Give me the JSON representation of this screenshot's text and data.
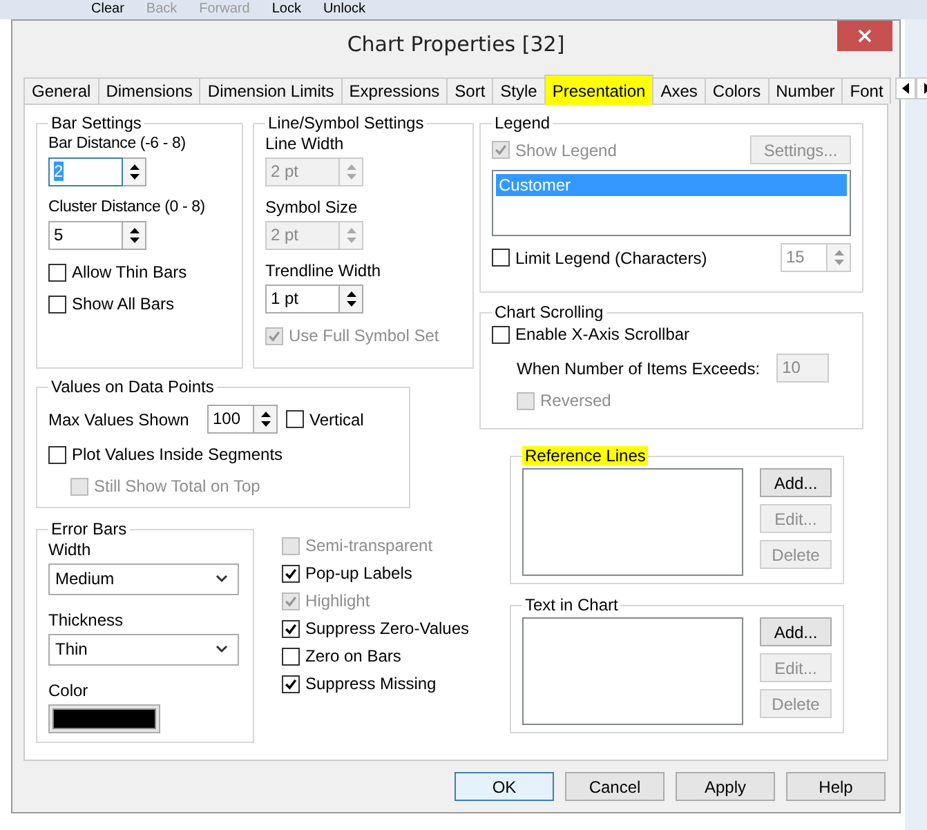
{
  "background_toolbar": [
    {
      "label": "Clear",
      "disabled": false
    },
    {
      "label": "Back",
      "disabled": true
    },
    {
      "label": "Forward",
      "disabled": true
    },
    {
      "label": "Lock",
      "disabled": false
    },
    {
      "label": "Unlock",
      "disabled": false
    }
  ],
  "window": {
    "title": "Chart Properties [32]"
  },
  "tabs": [
    {
      "label": "General",
      "selected": false,
      "highlighted": false
    },
    {
      "label": "Dimensions",
      "selected": false,
      "highlighted": false
    },
    {
      "label": "Dimension Limits",
      "selected": false,
      "highlighted": false
    },
    {
      "label": "Expressions",
      "selected": false,
      "highlighted": false
    },
    {
      "label": "Sort",
      "selected": false,
      "highlighted": false
    },
    {
      "label": "Style",
      "selected": false,
      "highlighted": false
    },
    {
      "label": "Presentation",
      "selected": true,
      "highlighted": true
    },
    {
      "label": "Axes",
      "selected": false,
      "highlighted": false
    },
    {
      "label": "Colors",
      "selected": false,
      "highlighted": false
    },
    {
      "label": "Number",
      "selected": false,
      "highlighted": false
    },
    {
      "label": "Font",
      "selected": false,
      "highlighted": false
    }
  ],
  "bar_settings": {
    "title": "Bar Settings",
    "fields": [
      {
        "label": "Bar Distance (-6 - 8)",
        "value": "2",
        "focused": true,
        "disabled": false
      },
      {
        "label": "Cluster Distance (0 - 8)",
        "value": "5",
        "focused": false,
        "disabled": false
      }
    ],
    "checkboxes": [
      {
        "label": "Allow Thin Bars",
        "checked": false,
        "disabled": false
      },
      {
        "label": "Show All Bars",
        "checked": false,
        "disabled": false
      }
    ]
  },
  "line_symbol_settings": {
    "title": "Line/Symbol Settings",
    "fields": [
      {
        "label": "Line Width",
        "value": "2 pt",
        "focused": false,
        "disabled": true
      },
      {
        "label": "Symbol Size",
        "value": "2 pt",
        "focused": false,
        "disabled": true
      },
      {
        "label": "Trendline Width",
        "value": "1 pt",
        "focused": false,
        "disabled": false
      }
    ],
    "checkbox": {
      "label": "Use Full Symbol Set",
      "checked": true,
      "disabled": true
    }
  },
  "values_on_data_points": {
    "title": "Values on Data Points",
    "max_values_label": "Max Values Shown",
    "max_values": "100",
    "vertical": {
      "label": "Vertical",
      "checked": false,
      "disabled": false
    },
    "plot_inside": {
      "label": "Plot Values Inside Segments",
      "checked": false,
      "disabled": false
    },
    "still_show_total": {
      "label": "Still Show Total on Top",
      "checked": false,
      "disabled": true
    }
  },
  "error_bars": {
    "title": "Error Bars",
    "width_label": "Width",
    "width": "Medium",
    "thickness_label": "Thickness",
    "thickness": "Thin",
    "color_label": "Color",
    "color": "#000000"
  },
  "options": [
    {
      "label": "Semi-transparent",
      "checked": false,
      "disabled": true
    },
    {
      "label": "Pop-up Labels",
      "checked": true,
      "disabled": false
    },
    {
      "label": "Highlight",
      "checked": true,
      "disabled": true
    },
    {
      "label": "Suppress Zero-Values",
      "checked": true,
      "disabled": false,
      "children": [
        {
          "label": "Zero on Bars",
          "checked": false,
          "disabled": false
        }
      ]
    },
    {
      "label": "Suppress Missing",
      "checked": true,
      "disabled": false
    }
  ],
  "legend": {
    "title": "Legend",
    "show_legend": {
      "label": "Show Legend",
      "checked": true,
      "disabled": true
    },
    "settings_button": {
      "label": "Settings...",
      "disabled": true
    },
    "items": [
      {
        "label": "Customer",
        "selected": true
      }
    ],
    "limit": {
      "label": "Limit Legend (Characters)",
      "checked": false,
      "disabled": false
    },
    "limit_value": "15",
    "limit_value_disabled": true
  },
  "chart_scrolling": {
    "title": "Chart Scrolling",
    "enable": {
      "label": "Enable X-Axis Scrollbar",
      "checked": false,
      "disabled": false
    },
    "exceeds_label": "When Number of Items Exceeds:",
    "exceeds_value": "10",
    "exceeds_disabled": true,
    "reversed": {
      "label": "Reversed",
      "checked": false,
      "disabled": true
    }
  },
  "reference_lines": {
    "title": "Reference Lines",
    "highlighted": true,
    "buttons": [
      {
        "label": "Add...",
        "disabled": false
      },
      {
        "label": "Edit...",
        "disabled": true
      },
      {
        "label": "Delete",
        "disabled": true
      }
    ]
  },
  "text_in_chart": {
    "title": "Text in Chart",
    "highlighted": false,
    "buttons": [
      {
        "label": "Add...",
        "disabled": false
      },
      {
        "label": "Edit...",
        "disabled": true
      },
      {
        "label": "Delete",
        "disabled": true
      }
    ]
  },
  "dialog_buttons": [
    {
      "label": "OK",
      "default": true
    },
    {
      "label": "Cancel",
      "default": false
    },
    {
      "label": "Apply",
      "default": false
    },
    {
      "label": "Help",
      "default": false
    }
  ]
}
